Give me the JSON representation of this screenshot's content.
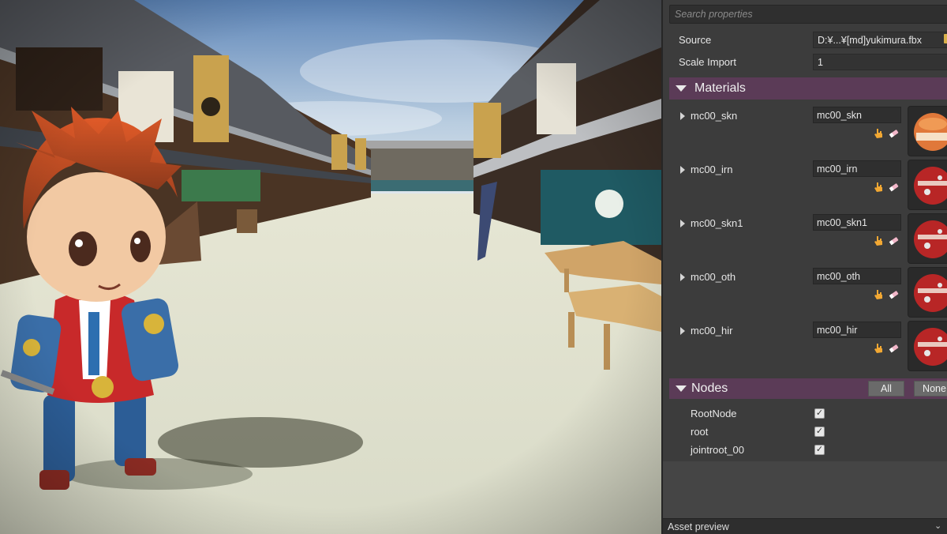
{
  "search": {
    "placeholder": "Search properties"
  },
  "properties": [
    {
      "label": "Source",
      "value": "D:¥...¥[md]yukimura.fbx"
    },
    {
      "label": "Scale Import",
      "value": "1"
    }
  ],
  "materials": {
    "title": "Materials",
    "items": [
      {
        "label": "mc00_skn",
        "value": "mc00_skn",
        "thumb": "skin"
      },
      {
        "label": "mc00_irn",
        "value": "mc00_irn",
        "thumb": "armor"
      },
      {
        "label": "mc00_skn1",
        "value": "mc00_skn1",
        "thumb": "armor"
      },
      {
        "label": "mc00_oth",
        "value": "mc00_oth",
        "thumb": "armor"
      },
      {
        "label": "mc00_hir",
        "value": "mc00_hir",
        "thumb": "armor"
      }
    ]
  },
  "nodes": {
    "title": "Nodes",
    "all_label": "All",
    "none_label": "None",
    "items": [
      {
        "label": "RootNode",
        "checked": true
      },
      {
        "label": "root",
        "checked": true
      },
      {
        "label": "jointroot_00",
        "checked": true
      }
    ]
  },
  "asset_preview": {
    "label": "Asset preview"
  },
  "colors": {
    "section_header": "#5b3b57",
    "panel_bg": "#3c3c3c",
    "field_bg": "#2f2f2f"
  },
  "icons": [
    "folder-icon",
    "collapse-triangle-icon",
    "expand-arrow-icon",
    "hand-pick-icon",
    "eraser-icon",
    "checkbox-icon",
    "chevron-down-icon"
  ]
}
